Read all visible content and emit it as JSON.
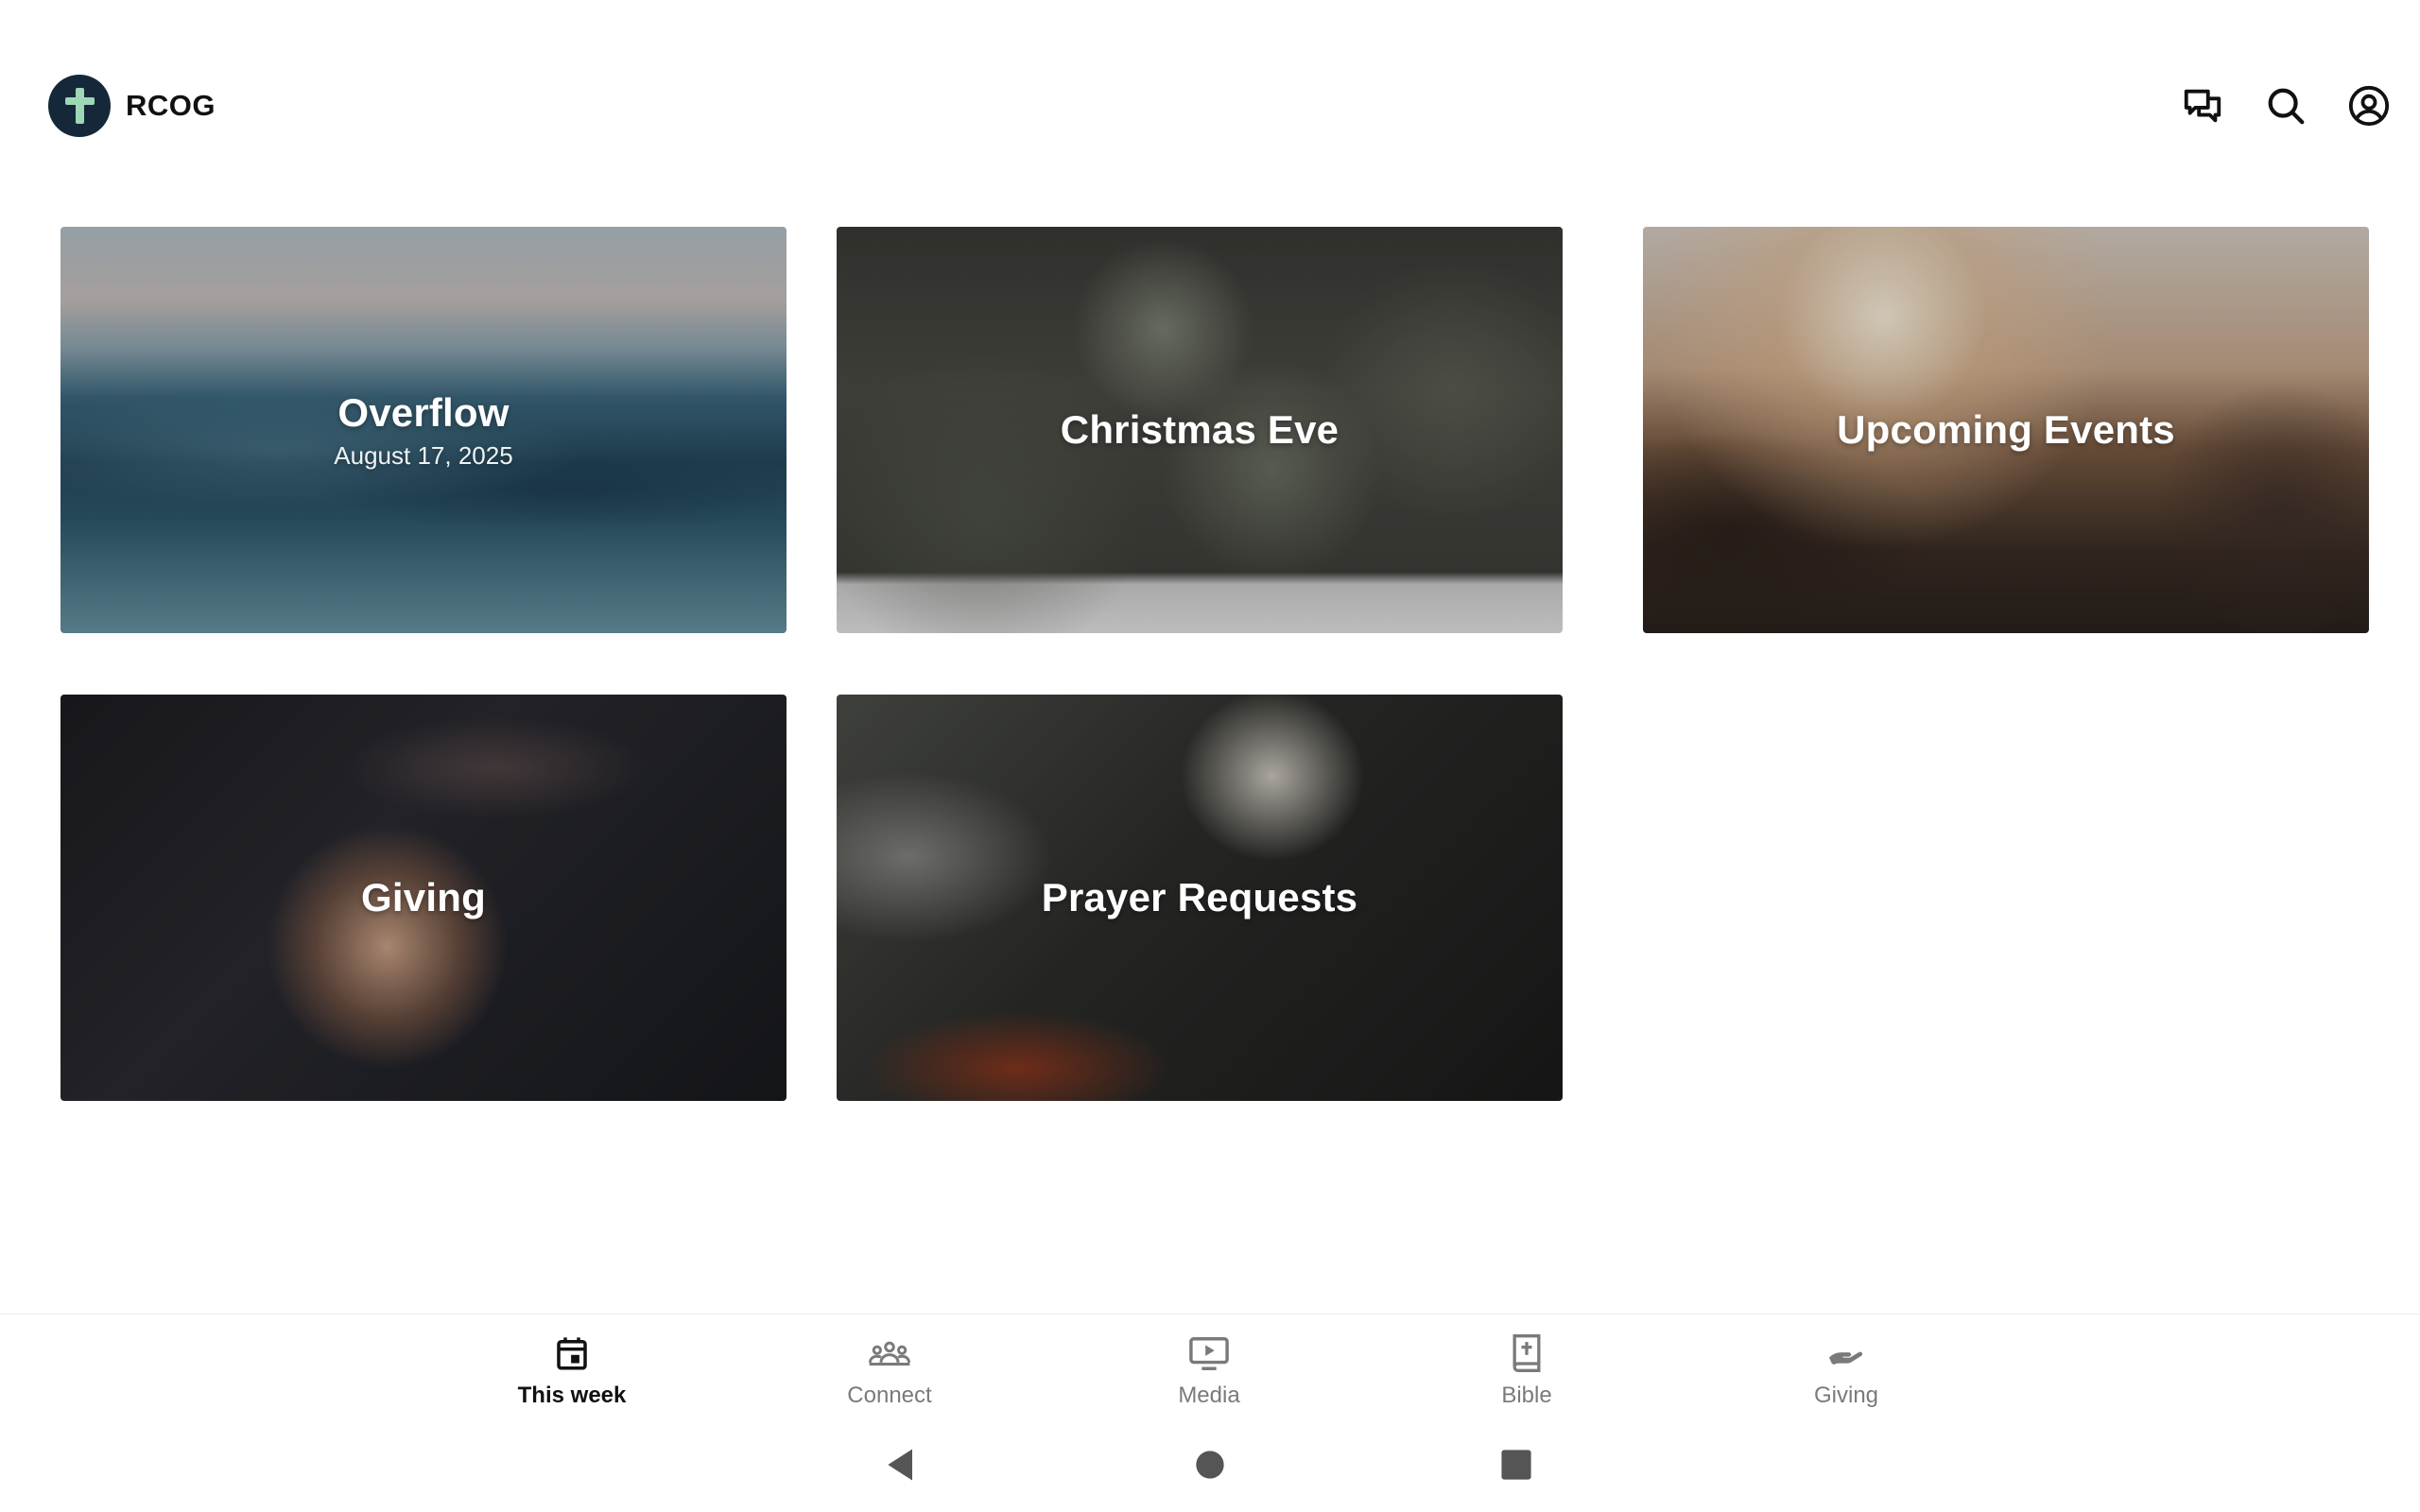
{
  "app": {
    "brand_name": "RCOG",
    "colors": {
      "logo_bg": "#14283a",
      "logo_cross": "#9ed7b5",
      "active_nav": "#111111",
      "inactive_nav": "#7a7a7a"
    }
  },
  "header": {
    "icons": [
      "chat-icon",
      "search-icon",
      "account-icon"
    ]
  },
  "cards": [
    {
      "title": "Overflow",
      "subtitle": "August 17, 2025"
    },
    {
      "title": "Christmas Eve",
      "subtitle": ""
    },
    {
      "title": "Upcoming Events",
      "subtitle": ""
    },
    {
      "title": "Giving",
      "subtitle": ""
    },
    {
      "title": "Prayer Requests",
      "subtitle": ""
    }
  ],
  "bottom_nav": {
    "items": [
      {
        "label": "This week",
        "icon": "calendar-icon",
        "active": true
      },
      {
        "label": "Connect",
        "icon": "people-icon",
        "active": false
      },
      {
        "label": "Media",
        "icon": "play-screen-icon",
        "active": false
      },
      {
        "label": "Bible",
        "icon": "bible-icon",
        "active": false
      },
      {
        "label": "Giving",
        "icon": "giving-hand-icon",
        "active": false
      }
    ]
  },
  "system_nav": {
    "buttons": [
      "back-icon",
      "home-icon",
      "recents-icon"
    ]
  }
}
